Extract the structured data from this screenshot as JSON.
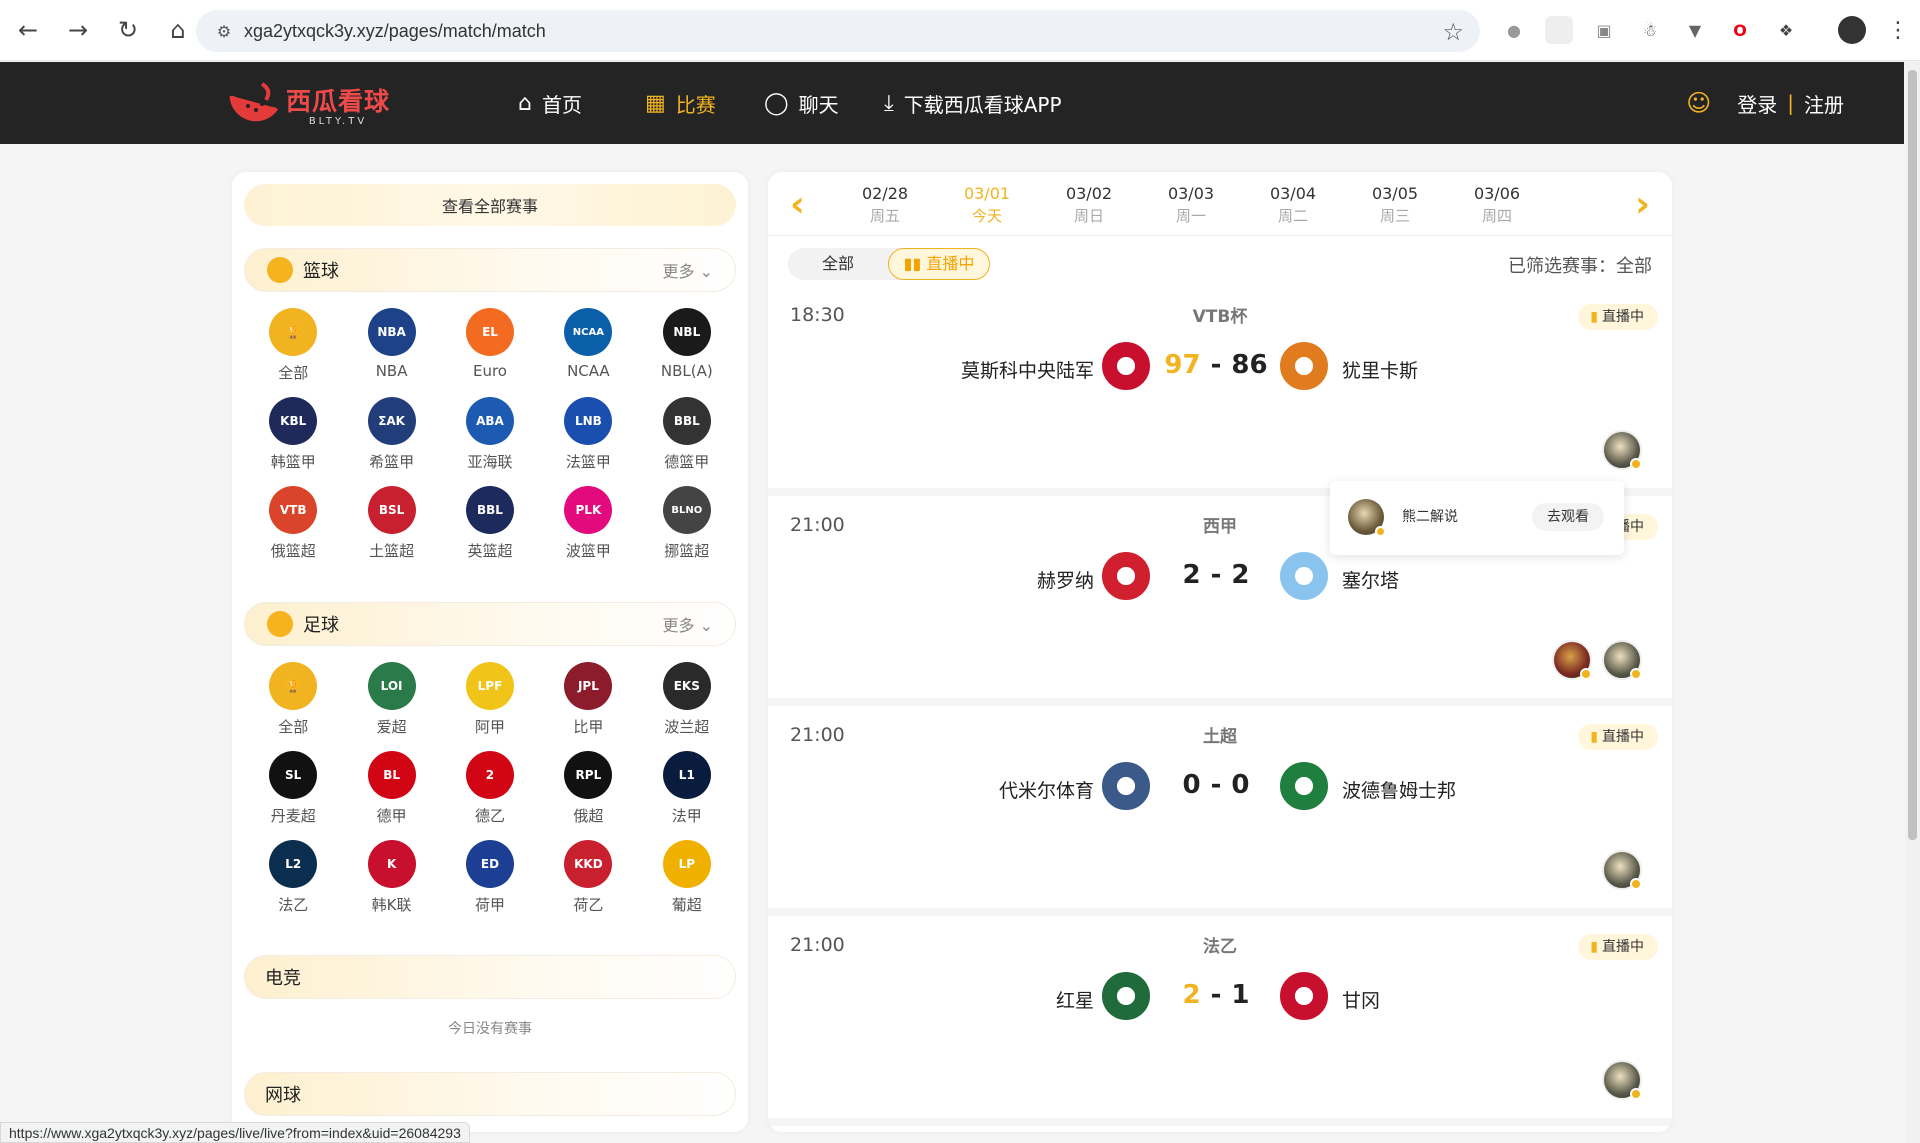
{
  "browser": {
    "url": "xga2ytxqck3y.xyz/pages/match/match",
    "status_url": "https://www.xga2ytxqck3y.xyz/pages/live/live?from=index&uid=26084293"
  },
  "header": {
    "logo_cn": "西瓜看球",
    "logo_en": "BLTY.TV",
    "nav": [
      {
        "label": "首页",
        "icon": "home-icon"
      },
      {
        "label": "比赛",
        "icon": "calendar-icon"
      },
      {
        "label": "聊天",
        "icon": "chat-icon"
      },
      {
        "label": "下载西瓜看球APP",
        "icon": "download-icon"
      }
    ],
    "login": "登录",
    "divider": "|",
    "register": "注册"
  },
  "left": {
    "view_all": "查看全部赛事",
    "basketball": {
      "title": "篮球",
      "more": "更多",
      "leagues": [
        {
          "name": "全部",
          "color": "#f2b320",
          "abbr": "🏆"
        },
        {
          "name": "NBA",
          "color": "#1d428a",
          "abbr": "NBA"
        },
        {
          "name": "Euro",
          "color": "#f36b21",
          "abbr": "EL"
        },
        {
          "name": "NCAA",
          "color": "#0a5fa8",
          "abbr": "NCAA"
        },
        {
          "name": "NBL(A)",
          "color": "#1a1a1a",
          "abbr": "NBL"
        },
        {
          "name": "韩篮甲",
          "color": "#1f2a5a",
          "abbr": "KBL"
        },
        {
          "name": "希篮甲",
          "color": "#213d7a",
          "abbr": "ΣΑΚ"
        },
        {
          "name": "亚海联",
          "color": "#1d5bb3",
          "abbr": "ABA"
        },
        {
          "name": "法篮甲",
          "color": "#1a4fb0",
          "abbr": "LNB"
        },
        {
          "name": "德篮甲",
          "color": "#333333",
          "abbr": "BBL"
        },
        {
          "name": "俄篮超",
          "color": "#d9442a",
          "abbr": "VTB"
        },
        {
          "name": "土篮超",
          "color": "#c8202f",
          "abbr": "BSL"
        },
        {
          "name": "英篮超",
          "color": "#1c2b5c",
          "abbr": "BBL"
        },
        {
          "name": "波篮甲",
          "color": "#e20a7c",
          "abbr": "PLK"
        },
        {
          "name": "挪篮超",
          "color": "#444444",
          "abbr": "BLNO"
        }
      ]
    },
    "football": {
      "title": "足球",
      "more": "更多",
      "leagues": [
        {
          "name": "全部",
          "color": "#f2b320",
          "abbr": "🏆"
        },
        {
          "name": "爱超",
          "color": "#2a7a4a",
          "abbr": "LOI"
        },
        {
          "name": "阿甲",
          "color": "#f0c419",
          "abbr": "LPF"
        },
        {
          "name": "比甲",
          "color": "#8c1b2c",
          "abbr": "JPL"
        },
        {
          "name": "波兰超",
          "color": "#2a2a2a",
          "abbr": "EKS"
        },
        {
          "name": "丹麦超",
          "color": "#111111",
          "abbr": "SL"
        },
        {
          "name": "德甲",
          "color": "#d20515",
          "abbr": "BL"
        },
        {
          "name": "德乙",
          "color": "#d20515",
          "abbr": "2"
        },
        {
          "name": "俄超",
          "color": "#111111",
          "abbr": "RPL"
        },
        {
          "name": "法甲",
          "color": "#091c3e",
          "abbr": "L1"
        },
        {
          "name": "法乙",
          "color": "#0b2e4f",
          "abbr": "L2"
        },
        {
          "name": "韩K联",
          "color": "#c8102e",
          "abbr": "K"
        },
        {
          "name": "荷甲",
          "color": "#1c3f94",
          "abbr": "ED"
        },
        {
          "name": "荷乙",
          "color": "#c8202f",
          "abbr": "KKD"
        },
        {
          "name": "葡超",
          "color": "#f0b000",
          "abbr": "LP"
        }
      ]
    },
    "esports": {
      "title": "电竞",
      "empty": "今日没有赛事"
    },
    "tennis": {
      "title": "网球"
    }
  },
  "right": {
    "dates": [
      {
        "date": "02/28",
        "weekday": "周五"
      },
      {
        "date": "03/01",
        "weekday": "今天"
      },
      {
        "date": "03/02",
        "weekday": "周日"
      },
      {
        "date": "03/03",
        "weekday": "周一"
      },
      {
        "date": "03/04",
        "weekday": "周二"
      },
      {
        "date": "03/05",
        "weekday": "周三"
      },
      {
        "date": "03/06",
        "weekday": "周四"
      }
    ],
    "filter_all": "全部",
    "filter_live": "直播中",
    "filter_label": "已筛选赛事：全部",
    "matches": [
      {
        "time": "18:30",
        "league": "VTB杯",
        "home": "莫斯科中央陆军",
        "away": "犹里卡斯",
        "home_score": "97",
        "away_score": "86",
        "leader": "home",
        "badge": "直播中",
        "home_color": "#c8102e",
        "away_color": "#e07b1e",
        "anchors": 1
      },
      {
        "time": "21:00",
        "league": "西甲",
        "home": "赫罗纳",
        "away": "塞尔塔",
        "home_score": "2",
        "away_score": "2",
        "leader": "none",
        "badge": "直播中",
        "home_color": "#d01f2e",
        "away_color": "#8ac3ee",
        "anchors": 2
      },
      {
        "time": "21:00",
        "league": "土超",
        "home": "代米尔体育",
        "away": "波德鲁姆士邦",
        "home_score": "0",
        "away_score": "0",
        "leader": "none",
        "badge": "直播中",
        "home_color": "#3b5a8a",
        "away_color": "#1e7f3e",
        "anchors": 1
      },
      {
        "time": "21:00",
        "league": "法乙",
        "home": "红星",
        "away": "甘冈",
        "home_score": "2",
        "away_score": "1",
        "leader": "home",
        "badge": "直播中",
        "home_color": "#1f6b3a",
        "away_color": "#c8102e",
        "anchors": 1
      }
    ],
    "popup": {
      "anchor": "熊二解说",
      "action": "去观看"
    }
  }
}
